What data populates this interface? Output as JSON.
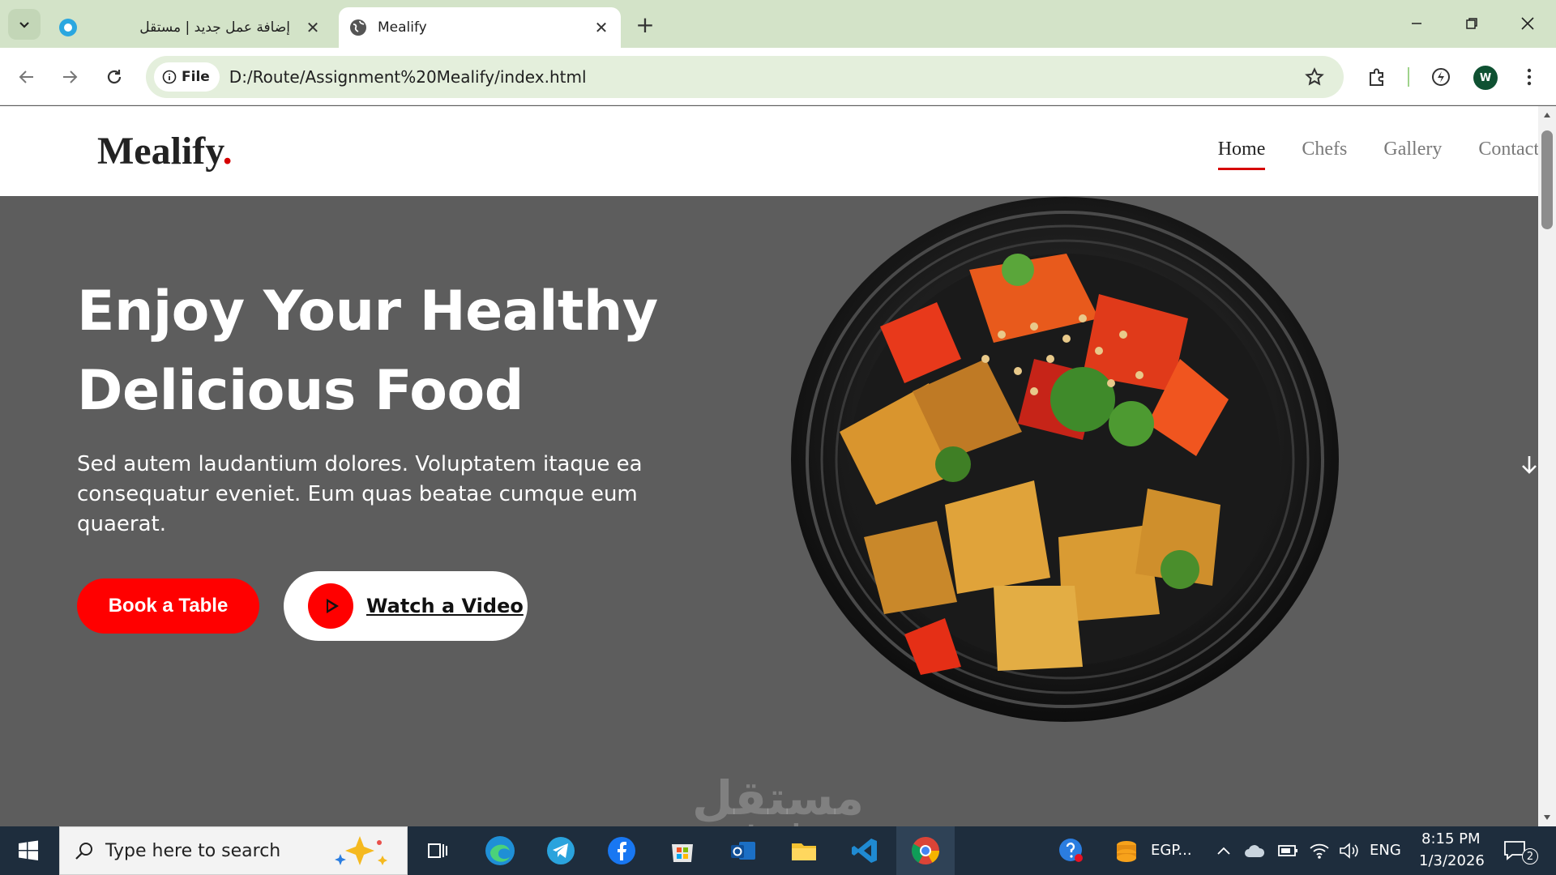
{
  "browser": {
    "tabs": [
      {
        "title": "إضافة عمل جديد | مستقل",
        "active": false
      },
      {
        "title": "Mealify",
        "active": true
      }
    ],
    "address": {
      "chip_label": "File",
      "url": "D:/Route/Assignment%20Mealify/index.html"
    },
    "profile_initial": "W"
  },
  "site": {
    "logo": {
      "text": "Mealify",
      "dot": "."
    },
    "nav": [
      {
        "label": "Home",
        "active": true
      },
      {
        "label": "Chefs",
        "active": false
      },
      {
        "label": "Gallery",
        "active": false
      },
      {
        "label": "Contact",
        "active": false
      }
    ],
    "hero": {
      "title_line1": "Enjoy Your Healthy",
      "title_line2": "Delicious Food",
      "description": "Sed autem laudantium dolores. Voluptatem itaque ea consequatur eveniet. Eum quas beatae cumque eum quaerat.",
      "book_label": "Book a Table",
      "watch_label": "Watch a Video"
    }
  },
  "watermark": {
    "arabic": "مستقل",
    "latin": "mostaql.com"
  },
  "taskbar": {
    "search_placeholder": "Type here to search",
    "currency_label": "EGP...",
    "language": "ENG",
    "time": "8:15 PM",
    "date": "1/3/2026",
    "notification_count": "2"
  },
  "colors": {
    "accent": "#ff0000",
    "hero_bg": "#5d5d5d",
    "tabstrip": "#d3e3c8"
  }
}
